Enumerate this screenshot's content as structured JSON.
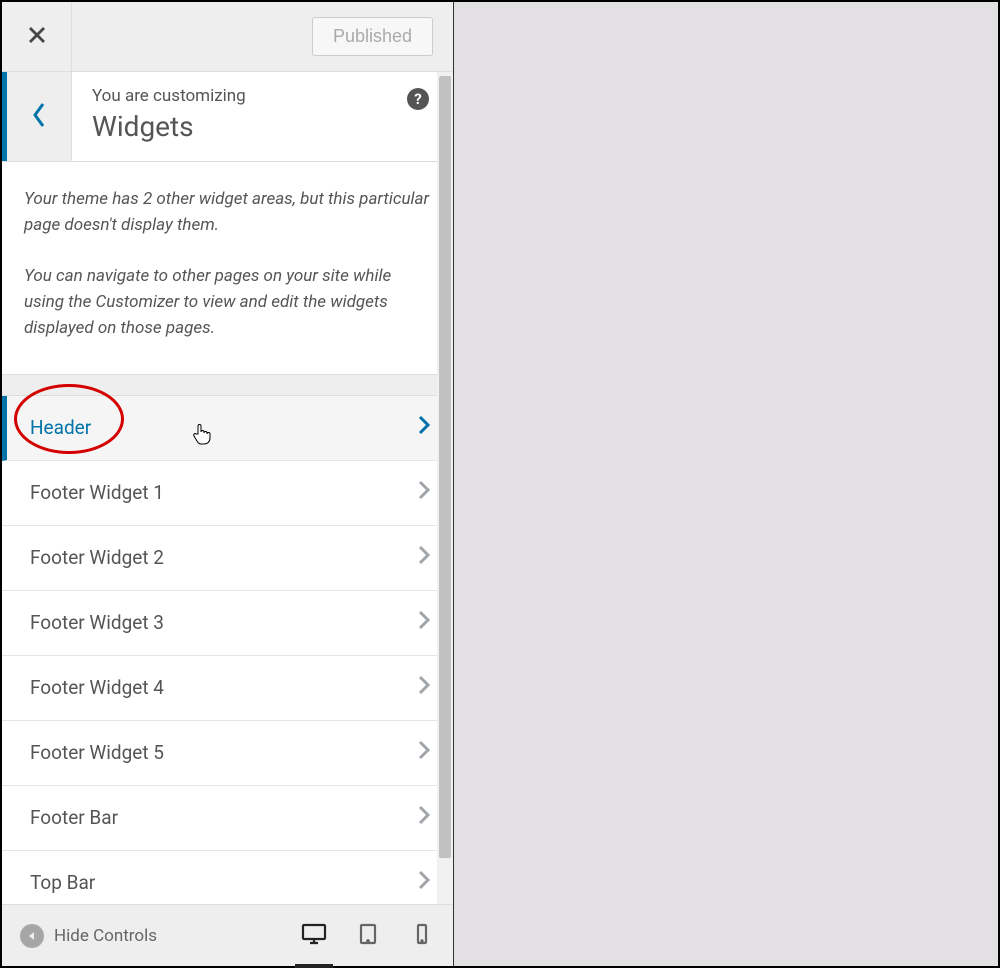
{
  "topbar": {
    "publish_label": "Published"
  },
  "panel": {
    "subtitle": "You are customizing",
    "title": "Widgets",
    "help_symbol": "?"
  },
  "description": {
    "p1": "Your theme has 2 other widget areas, but this particular page doesn't display them.",
    "p2": "You can navigate to other pages on your site while using the Customizer to view and edit the widgets displayed on those pages."
  },
  "areas": [
    {
      "label": "Header",
      "active": true
    },
    {
      "label": "Footer Widget 1",
      "active": false
    },
    {
      "label": "Footer Widget 2",
      "active": false
    },
    {
      "label": "Footer Widget 3",
      "active": false
    },
    {
      "label": "Footer Widget 4",
      "active": false
    },
    {
      "label": "Footer Widget 5",
      "active": false
    },
    {
      "label": "Footer Bar",
      "active": false
    },
    {
      "label": "Top Bar",
      "active": false
    }
  ],
  "footer": {
    "hide_label": "Hide Controls"
  }
}
